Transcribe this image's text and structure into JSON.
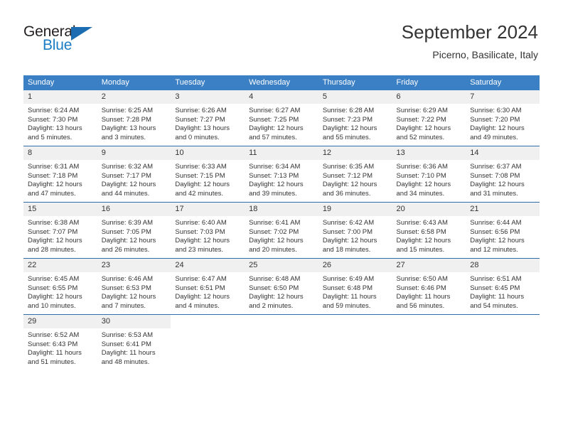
{
  "brand": {
    "name_part1": "General",
    "name_part2": "Blue",
    "triangle_icon": "triangle-icon",
    "accent_color": "#1b7dc4"
  },
  "header": {
    "title": "September 2024",
    "subtitle": "Picerno, Basilicate, Italy"
  },
  "theme": {
    "header_bg": "#3b7fc4",
    "daynum_bg": "#f0f0f0",
    "week_divider": "#2f6fab",
    "text": "#333333"
  },
  "weekdays": [
    "Sunday",
    "Monday",
    "Tuesday",
    "Wednesday",
    "Thursday",
    "Friday",
    "Saturday"
  ],
  "weeks": [
    [
      {
        "day": "1",
        "sunrise": "Sunrise: 6:24 AM",
        "sunset": "Sunset: 7:30 PM",
        "daylight1": "Daylight: 13 hours",
        "daylight2": "and 5 minutes."
      },
      {
        "day": "2",
        "sunrise": "Sunrise: 6:25 AM",
        "sunset": "Sunset: 7:28 PM",
        "daylight1": "Daylight: 13 hours",
        "daylight2": "and 3 minutes."
      },
      {
        "day": "3",
        "sunrise": "Sunrise: 6:26 AM",
        "sunset": "Sunset: 7:27 PM",
        "daylight1": "Daylight: 13 hours",
        "daylight2": "and 0 minutes."
      },
      {
        "day": "4",
        "sunrise": "Sunrise: 6:27 AM",
        "sunset": "Sunset: 7:25 PM",
        "daylight1": "Daylight: 12 hours",
        "daylight2": "and 57 minutes."
      },
      {
        "day": "5",
        "sunrise": "Sunrise: 6:28 AM",
        "sunset": "Sunset: 7:23 PM",
        "daylight1": "Daylight: 12 hours",
        "daylight2": "and 55 minutes."
      },
      {
        "day": "6",
        "sunrise": "Sunrise: 6:29 AM",
        "sunset": "Sunset: 7:22 PM",
        "daylight1": "Daylight: 12 hours",
        "daylight2": "and 52 minutes."
      },
      {
        "day": "7",
        "sunrise": "Sunrise: 6:30 AM",
        "sunset": "Sunset: 7:20 PM",
        "daylight1": "Daylight: 12 hours",
        "daylight2": "and 49 minutes."
      }
    ],
    [
      {
        "day": "8",
        "sunrise": "Sunrise: 6:31 AM",
        "sunset": "Sunset: 7:18 PM",
        "daylight1": "Daylight: 12 hours",
        "daylight2": "and 47 minutes."
      },
      {
        "day": "9",
        "sunrise": "Sunrise: 6:32 AM",
        "sunset": "Sunset: 7:17 PM",
        "daylight1": "Daylight: 12 hours",
        "daylight2": "and 44 minutes."
      },
      {
        "day": "10",
        "sunrise": "Sunrise: 6:33 AM",
        "sunset": "Sunset: 7:15 PM",
        "daylight1": "Daylight: 12 hours",
        "daylight2": "and 42 minutes."
      },
      {
        "day": "11",
        "sunrise": "Sunrise: 6:34 AM",
        "sunset": "Sunset: 7:13 PM",
        "daylight1": "Daylight: 12 hours",
        "daylight2": "and 39 minutes."
      },
      {
        "day": "12",
        "sunrise": "Sunrise: 6:35 AM",
        "sunset": "Sunset: 7:12 PM",
        "daylight1": "Daylight: 12 hours",
        "daylight2": "and 36 minutes."
      },
      {
        "day": "13",
        "sunrise": "Sunrise: 6:36 AM",
        "sunset": "Sunset: 7:10 PM",
        "daylight1": "Daylight: 12 hours",
        "daylight2": "and 34 minutes."
      },
      {
        "day": "14",
        "sunrise": "Sunrise: 6:37 AM",
        "sunset": "Sunset: 7:08 PM",
        "daylight1": "Daylight: 12 hours",
        "daylight2": "and 31 minutes."
      }
    ],
    [
      {
        "day": "15",
        "sunrise": "Sunrise: 6:38 AM",
        "sunset": "Sunset: 7:07 PM",
        "daylight1": "Daylight: 12 hours",
        "daylight2": "and 28 minutes."
      },
      {
        "day": "16",
        "sunrise": "Sunrise: 6:39 AM",
        "sunset": "Sunset: 7:05 PM",
        "daylight1": "Daylight: 12 hours",
        "daylight2": "and 26 minutes."
      },
      {
        "day": "17",
        "sunrise": "Sunrise: 6:40 AM",
        "sunset": "Sunset: 7:03 PM",
        "daylight1": "Daylight: 12 hours",
        "daylight2": "and 23 minutes."
      },
      {
        "day": "18",
        "sunrise": "Sunrise: 6:41 AM",
        "sunset": "Sunset: 7:02 PM",
        "daylight1": "Daylight: 12 hours",
        "daylight2": "and 20 minutes."
      },
      {
        "day": "19",
        "sunrise": "Sunrise: 6:42 AM",
        "sunset": "Sunset: 7:00 PM",
        "daylight1": "Daylight: 12 hours",
        "daylight2": "and 18 minutes."
      },
      {
        "day": "20",
        "sunrise": "Sunrise: 6:43 AM",
        "sunset": "Sunset: 6:58 PM",
        "daylight1": "Daylight: 12 hours",
        "daylight2": "and 15 minutes."
      },
      {
        "day": "21",
        "sunrise": "Sunrise: 6:44 AM",
        "sunset": "Sunset: 6:56 PM",
        "daylight1": "Daylight: 12 hours",
        "daylight2": "and 12 minutes."
      }
    ],
    [
      {
        "day": "22",
        "sunrise": "Sunrise: 6:45 AM",
        "sunset": "Sunset: 6:55 PM",
        "daylight1": "Daylight: 12 hours",
        "daylight2": "and 10 minutes."
      },
      {
        "day": "23",
        "sunrise": "Sunrise: 6:46 AM",
        "sunset": "Sunset: 6:53 PM",
        "daylight1": "Daylight: 12 hours",
        "daylight2": "and 7 minutes."
      },
      {
        "day": "24",
        "sunrise": "Sunrise: 6:47 AM",
        "sunset": "Sunset: 6:51 PM",
        "daylight1": "Daylight: 12 hours",
        "daylight2": "and 4 minutes."
      },
      {
        "day": "25",
        "sunrise": "Sunrise: 6:48 AM",
        "sunset": "Sunset: 6:50 PM",
        "daylight1": "Daylight: 12 hours",
        "daylight2": "and 2 minutes."
      },
      {
        "day": "26",
        "sunrise": "Sunrise: 6:49 AM",
        "sunset": "Sunset: 6:48 PM",
        "daylight1": "Daylight: 11 hours",
        "daylight2": "and 59 minutes."
      },
      {
        "day": "27",
        "sunrise": "Sunrise: 6:50 AM",
        "sunset": "Sunset: 6:46 PM",
        "daylight1": "Daylight: 11 hours",
        "daylight2": "and 56 minutes."
      },
      {
        "day": "28",
        "sunrise": "Sunrise: 6:51 AM",
        "sunset": "Sunset: 6:45 PM",
        "daylight1": "Daylight: 11 hours",
        "daylight2": "and 54 minutes."
      }
    ],
    [
      {
        "day": "29",
        "sunrise": "Sunrise: 6:52 AM",
        "sunset": "Sunset: 6:43 PM",
        "daylight1": "Daylight: 11 hours",
        "daylight2": "and 51 minutes."
      },
      {
        "day": "30",
        "sunrise": "Sunrise: 6:53 AM",
        "sunset": "Sunset: 6:41 PM",
        "daylight1": "Daylight: 11 hours",
        "daylight2": "and 48 minutes."
      },
      {
        "day": "",
        "sunrise": "",
        "sunset": "",
        "daylight1": "",
        "daylight2": ""
      },
      {
        "day": "",
        "sunrise": "",
        "sunset": "",
        "daylight1": "",
        "daylight2": ""
      },
      {
        "day": "",
        "sunrise": "",
        "sunset": "",
        "daylight1": "",
        "daylight2": ""
      },
      {
        "day": "",
        "sunrise": "",
        "sunset": "",
        "daylight1": "",
        "daylight2": ""
      },
      {
        "day": "",
        "sunrise": "",
        "sunset": "",
        "daylight1": "",
        "daylight2": ""
      }
    ]
  ]
}
